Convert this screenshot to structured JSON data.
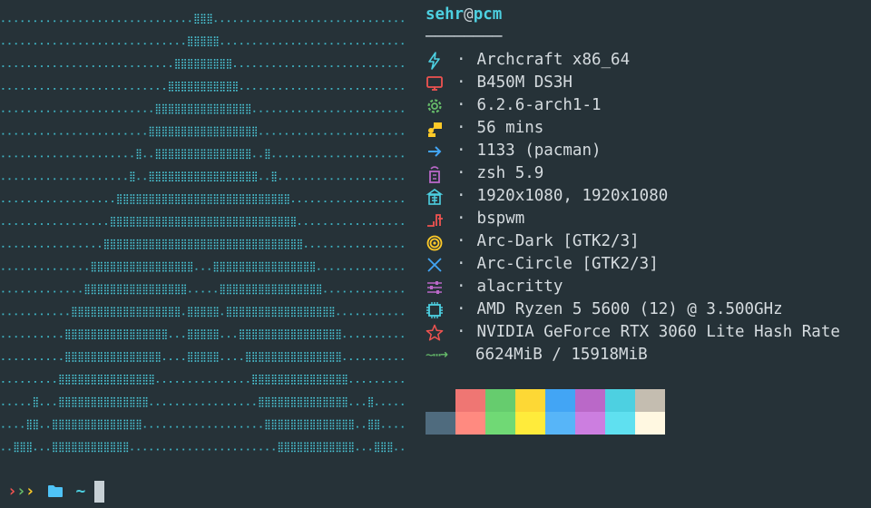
{
  "title": {
    "user": "sehr",
    "at": "@",
    "host": "pcm",
    "separator": "────────"
  },
  "info": [
    {
      "icon": "lightning-icon",
      "color": "#4dd0e1",
      "value": "Archcraft x86_64"
    },
    {
      "icon": "monitor-icon",
      "color": "#ef5350",
      "value": "B450M DS3H"
    },
    {
      "icon": "gear-icon",
      "color": "#66bb6a",
      "value": "6.2.6-arch1-1"
    },
    {
      "icon": "presenter-icon",
      "color": "#ffca28",
      "value": "56 mins"
    },
    {
      "icon": "arrow-right-icon",
      "color": "#42a5f5",
      "value": "1133 (pacman)"
    },
    {
      "icon": "shell-icon",
      "color": "#ba68c8",
      "value": "zsh 5.9"
    },
    {
      "icon": "display-icon",
      "color": "#4dd0e1",
      "value": "1920x1080, 1920x1080"
    },
    {
      "icon": "window-manager-icon",
      "color": "#ef5350",
      "value": "bspwm"
    },
    {
      "icon": "theme-icon",
      "color": "#ffca28",
      "value": "Arc-Dark [GTK2/3]"
    },
    {
      "icon": "icons-x-icon",
      "color": "#42a5f5",
      "value": "Arc-Circle [GTK2/3]"
    },
    {
      "icon": "sliders-icon",
      "color": "#ba68c8",
      "value": "alacritty"
    },
    {
      "icon": "cpu-icon",
      "color": "#4dd0e1",
      "value": "AMD Ryzen 5 5600 (12) @ 3.500GHz"
    },
    {
      "icon": "star-icon",
      "color": "#ef5350",
      "value": "NVIDIA GeForce RTX 3060 Lite Hash Rate"
    }
  ],
  "memory": {
    "arrow": "~⋯➜",
    "value": "6624MiB / 15918MiB"
  },
  "bullet": "·",
  "palette": {
    "normal": [
      "#263238",
      "#ef7673",
      "#66cc6e",
      "#fdd835",
      "#42a5f5",
      "#ba68c8",
      "#4dd0e1",
      "#c4bdb0"
    ],
    "bright": [
      "#4f6b7e",
      "#ff8a80",
      "#70d975",
      "#ffeb3b",
      "#57b5f8",
      "#cc7ee0",
      "#5fe0f0",
      "#fff8e1"
    ]
  },
  "prompt": {
    "chevron": "›",
    "chevron_colors": [
      "#ef5350",
      "#66bb6a",
      "#ffca28"
    ],
    "tilde": "~"
  },
  "colors": {
    "background": "#263238",
    "accent": "#4dd0e1",
    "text": "#d5dbdf"
  }
}
